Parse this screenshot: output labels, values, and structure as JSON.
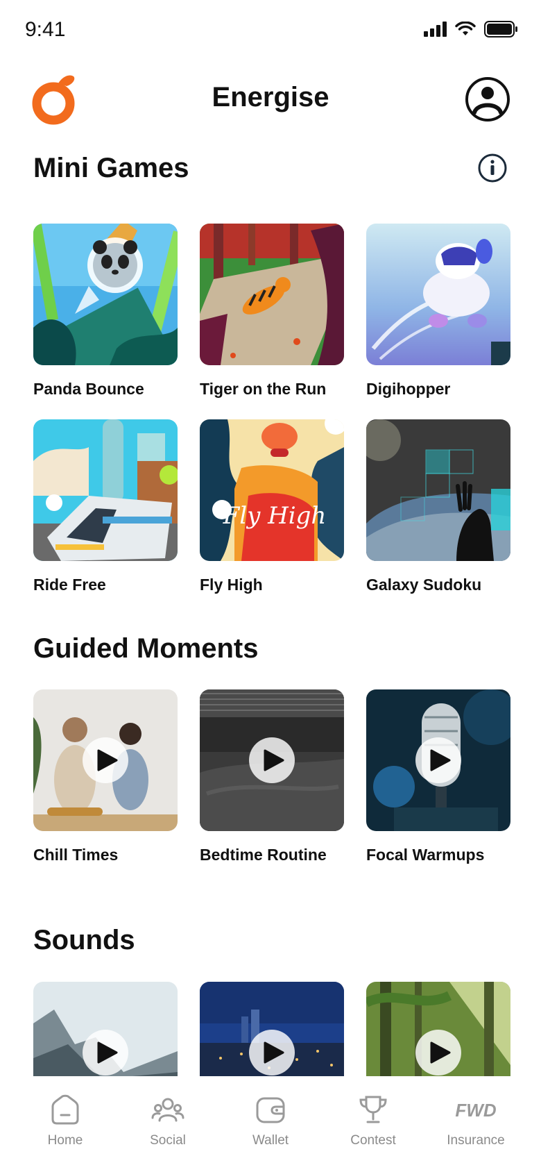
{
  "status": {
    "time": "9:41"
  },
  "header": {
    "title": "Energise"
  },
  "mini_games": {
    "title": "Mini Games",
    "items": [
      {
        "label": "Panda Bounce"
      },
      {
        "label": "Tiger on the Run"
      },
      {
        "label": "Digihopper"
      },
      {
        "label": "Ride Free"
      },
      {
        "label": "Fly High",
        "artwork_text": "Fly High"
      },
      {
        "label": "Galaxy Sudoku"
      }
    ]
  },
  "guided_moments": {
    "title": "Guided Moments",
    "items": [
      {
        "label": "Chill Times"
      },
      {
        "label": "Bedtime Routine"
      },
      {
        "label": "Focal Warmups"
      }
    ]
  },
  "sounds": {
    "title": "Sounds"
  },
  "nav": {
    "items": [
      {
        "label": "Home",
        "icon": "home-icon"
      },
      {
        "label": "Social",
        "icon": "social-icon"
      },
      {
        "label": "Wallet",
        "icon": "wallet-icon"
      },
      {
        "label": "Contest",
        "icon": "trophy-icon"
      },
      {
        "label": "Insurance",
        "icon": "fwd-logo-icon",
        "logo_text": "FWD"
      }
    ]
  },
  "colors": {
    "brand_orange": "#F26B1D",
    "text": "#111111",
    "nav_inactive": "#8A8A8A"
  }
}
